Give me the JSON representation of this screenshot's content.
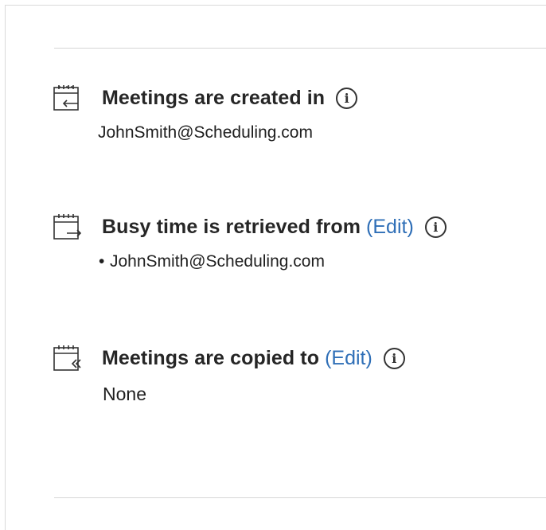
{
  "sections": {
    "created": {
      "title": "Meetings are created in",
      "value": "JohnSmith@Scheduling.com",
      "icon": "calendar-arrow-in-icon"
    },
    "busy": {
      "title": "Busy time is retrieved from",
      "edit_label": "Edit",
      "items": [
        "JohnSmith@Scheduling.com"
      ],
      "icon": "calendar-arrow-out-icon"
    },
    "copied": {
      "title": "Meetings are copied to",
      "edit_label": "Edit",
      "value": "None",
      "icon": "calendar-double-chevron-icon"
    }
  },
  "info_glyph": "i",
  "colors": {
    "link": "#2f6fb7",
    "text": "#1f1f1f",
    "divider": "#d6d6d6"
  }
}
